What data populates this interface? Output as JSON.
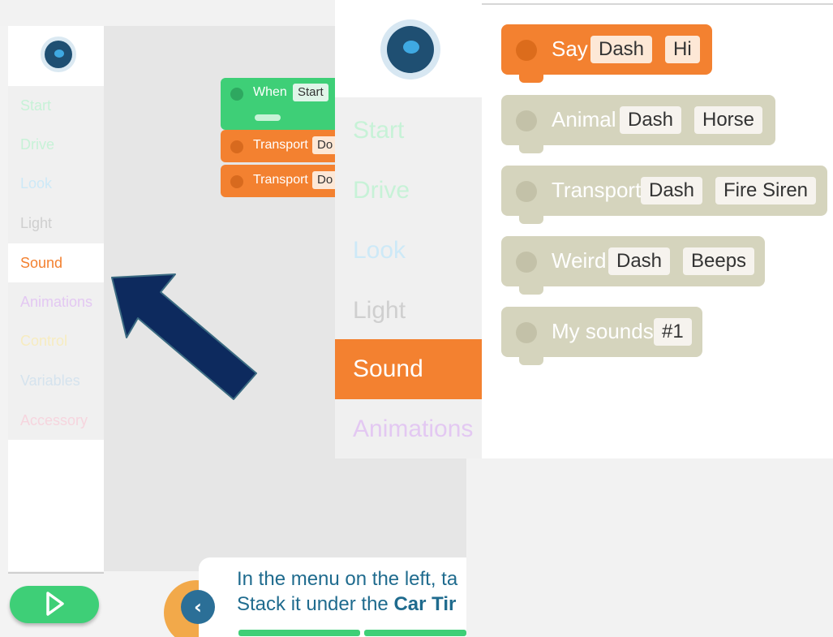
{
  "left": {
    "categories": [
      "Start",
      "Drive",
      "Look",
      "Light",
      "Sound",
      "Animations",
      "Control",
      "Variables",
      "Accessory"
    ],
    "category_colors": [
      "#c7f2d7",
      "#c7f2d7",
      "#cde9f7",
      "#cfcfcf",
      "#f38130",
      "#e3c8f2",
      "#f7ecc0",
      "#d5e3ee",
      "#f6d5de"
    ],
    "active_category": "Sound",
    "blocks": [
      {
        "label": "When",
        "param": "Start"
      },
      {
        "label": "Transport",
        "param": "Do"
      },
      {
        "label": "Transport",
        "param": "Do"
      }
    ],
    "tutorial": {
      "line1": "In the menu on the left, ta",
      "line2_prefix": "Stack it under the ",
      "line2_bold": "Car Tir",
      "back_glyph": "‹"
    }
  },
  "right": {
    "categories": [
      "Start",
      "Drive",
      "Look",
      "Light",
      "Sound",
      "Animations"
    ],
    "category_colors": [
      "#c7f2d7",
      "#c7f2d7",
      "#cde9f7",
      "#cfcfcf",
      "#ffffff",
      "#e3c8f2"
    ],
    "active_category": "Sound",
    "blocks": [
      {
        "label": "Say",
        "params": [
          "Dash",
          "Hi"
        ]
      },
      {
        "label": "Animal",
        "params": [
          "Dash",
          "Horse"
        ]
      },
      {
        "label": "Transport",
        "params": [
          "Dash",
          "Fire Siren"
        ]
      },
      {
        "label": "Weird",
        "params": [
          "Dash",
          "Beeps"
        ]
      },
      {
        "label": "My sounds",
        "params": [
          "#1"
        ]
      }
    ]
  },
  "icons": {
    "logo": "robot-avatar-icon",
    "play": "play-icon",
    "arrow": "pointer-arrow-icon",
    "back": "chevron-left-icon"
  },
  "colors": {
    "accent_orange": "#f38130",
    "accent_green": "#3ecf77",
    "arrow_navy": "#0d2a5e",
    "tutorial_text": "#1f6b8e"
  }
}
